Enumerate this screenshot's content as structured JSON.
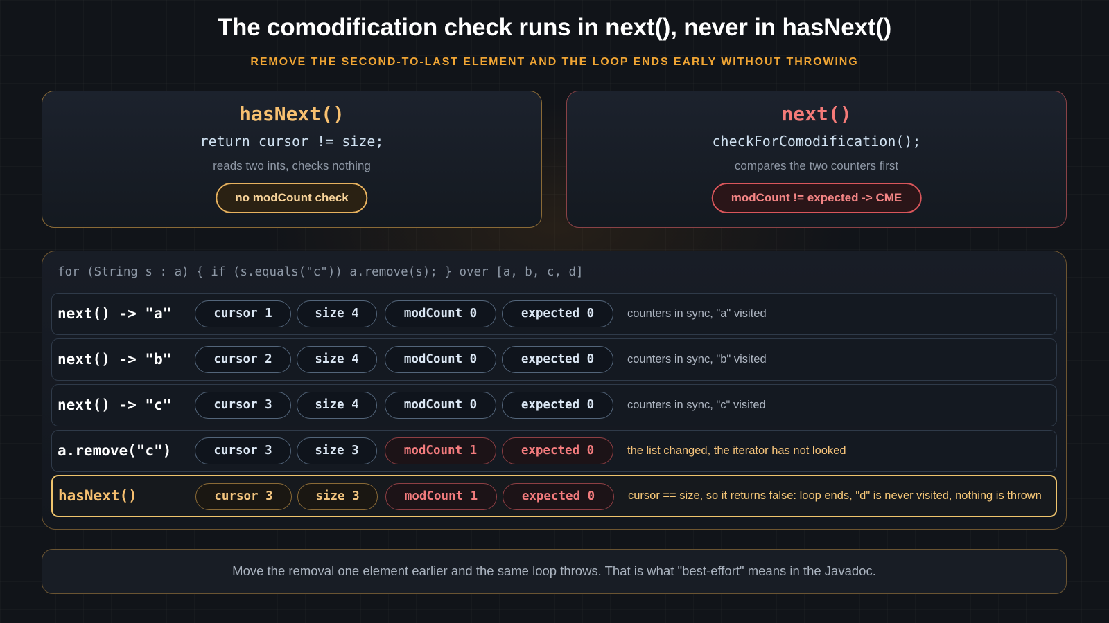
{
  "header": {
    "title": "The comodification check runs in next(), never in hasNext()",
    "subtitle": "REMOVE THE SECOND-TO-LAST ELEMENT AND THE LOOP ENDS EARLY WITHOUT THROWING"
  },
  "cards": {
    "has_next": {
      "title": "hasNext()",
      "code": "return cursor != size;",
      "note": "reads two ints, checks nothing",
      "badge": "no modCount check"
    },
    "next": {
      "title": "next()",
      "code": "checkForComodification();",
      "note": "compares the two counters first",
      "badge": "modCount != expected -> CME"
    }
  },
  "trace": {
    "code": "for (String s : a) { if (s.equals(\"c\")) a.remove(s); } over [a, b, c, d]",
    "rows": [
      {
        "label": "next() -> \"a\"",
        "cursor": "cursor 1",
        "size": "size 4",
        "modcount": "modCount 0",
        "expected": "expected 0",
        "note": "counters in sync, \"a\" visited"
      },
      {
        "label": "next() -> \"b\"",
        "cursor": "cursor 2",
        "size": "size 4",
        "modcount": "modCount 0",
        "expected": "expected 0",
        "note": "counters in sync, \"b\" visited"
      },
      {
        "label": "next() -> \"c\"",
        "cursor": "cursor 3",
        "size": "size 4",
        "modcount": "modCount 0",
        "expected": "expected 0",
        "note": "counters in sync, \"c\" visited"
      },
      {
        "label": "a.remove(\"c\")",
        "cursor": "cursor 3",
        "size": "size 3",
        "modcount": "modCount 1",
        "expected": "expected 0",
        "note": "the list changed, the iterator has not looked"
      },
      {
        "label": "hasNext()",
        "cursor": "cursor 3",
        "size": "size 3",
        "modcount": "modCount 1",
        "expected": "expected 0",
        "note": "cursor == size, so it returns false: loop ends, \"d\" is never visited, nothing is thrown"
      }
    ]
  },
  "footer": {
    "text": "Move the removal one element earlier and the same loop throws. That is what \"best-effort\" means in the Javadoc."
  }
}
